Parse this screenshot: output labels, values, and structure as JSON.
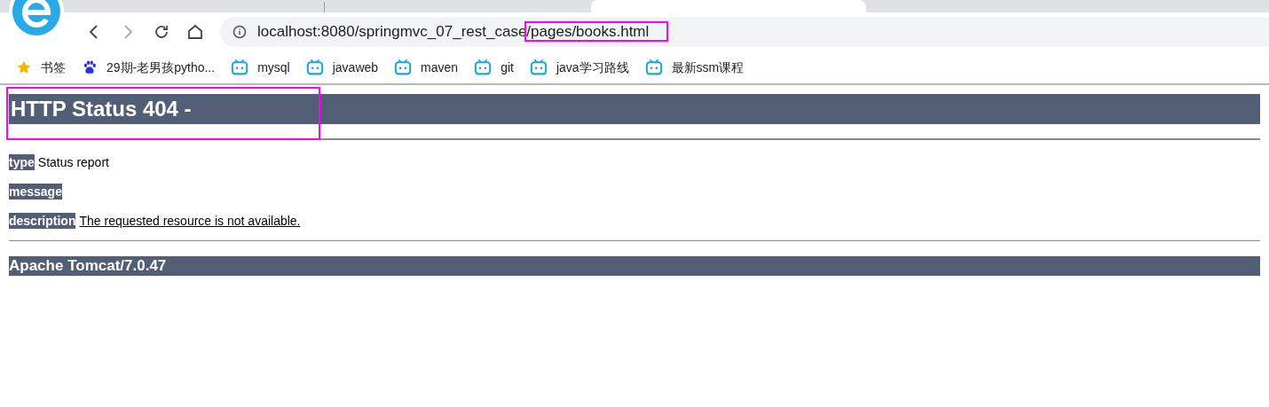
{
  "address_bar": {
    "url_parts": [
      {
        "text": "localhost:8080/springmvc_07_rest_case",
        "highlighted": false
      },
      {
        "text": "/pages/books.html",
        "highlighted": true
      }
    ]
  },
  "bookmarks": [
    {
      "label": "书签",
      "kind": "star"
    },
    {
      "label": "29期-老男孩pytho...",
      "kind": "paw"
    },
    {
      "label": "mysql",
      "kind": "tv"
    },
    {
      "label": "javaweb",
      "kind": "tv"
    },
    {
      "label": "maven",
      "kind": "tv"
    },
    {
      "label": "git",
      "kind": "tv"
    },
    {
      "label": "java学习路线",
      "kind": "tv"
    },
    {
      "label": "最新ssm课程",
      "kind": "tv"
    }
  ],
  "page": {
    "heading": {
      "text": "HTTP Status 404 -",
      "highlighted": true
    },
    "fields": [
      {
        "label": "type",
        "value": "Status report"
      },
      {
        "label": "message"
      },
      {
        "label": "description",
        "value": "The requested resource is not available."
      }
    ],
    "footer": "Apache Tomcat/7.0.47"
  }
}
